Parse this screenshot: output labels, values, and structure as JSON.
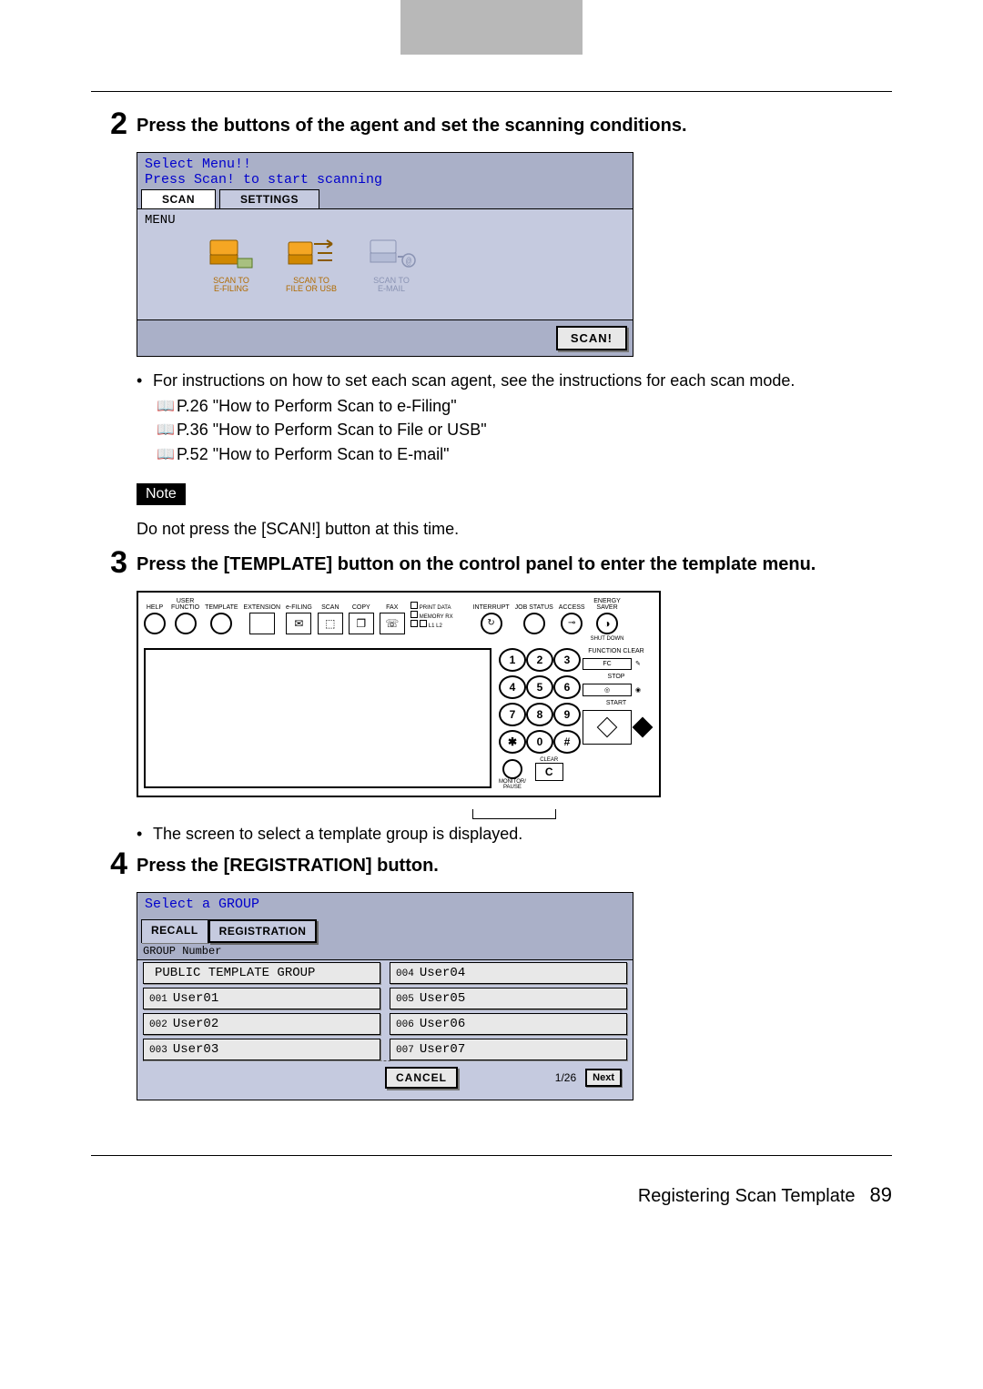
{
  "step2": {
    "num": "2",
    "title": "Press the buttons of the agent and set the scanning conditions.",
    "screen": {
      "title1": "Select Menu!!",
      "title2": "Press Scan! to start scanning",
      "tab_scan": "SCAN",
      "tab_settings": "SETTINGS",
      "menu_label": "MENU",
      "agents": {
        "efiling": "SCAN TO\nE-FILING",
        "fileusb": "SCAN TO\nFILE OR USB",
        "email": "SCAN TO\nE-MAIL"
      },
      "scan_btn": "SCAN!"
    },
    "bullet": "For instructions on how to set each scan agent, see the instructions for each scan mode.",
    "refs": {
      "r1": "P.26 \"How to Perform Scan to e-Filing\"",
      "r2": "P.36 \"How to Perform Scan to File or USB\"",
      "r3": "P.52 \"How to Perform Scan to E-mail\""
    },
    "note_label": "Note",
    "note_text": "Do not press the [SCAN!] button at this time."
  },
  "step3": {
    "num": "3",
    "title": "Press the [TEMPLATE] button on the control panel to enter the template menu.",
    "panel_labels": {
      "help": "HELP",
      "userfn": "USER\nFUNCTIO",
      "template": "TEMPLATE",
      "extension": "EXTENSION",
      "efiling": "e-FILING",
      "scan": "SCAN",
      "copy": "COPY",
      "fax": "FAX",
      "printdata": "PRINT DATA",
      "memoryrx": "MEMORY RX",
      "l1l2": "L1    L2",
      "interrupt": "INTERRUPT",
      "jobstatus": "JOB STATUS",
      "access": "ACCESS",
      "energy": "ENERGY\nSAVER",
      "shutdown": "SHUT DOWN",
      "functionclear": "FUNCTION CLEAR",
      "fc": "FC",
      "stop": "STOP",
      "start": "START",
      "monitor": "MONITOR/\nPAUSE",
      "clear": "CLEAR",
      "c": "C"
    },
    "bullet": "The screen to select a template group is displayed."
  },
  "step4": {
    "num": "4",
    "title": "Press the [REGISTRATION] button.",
    "screen": {
      "title": "Select a GROUP",
      "tab_recall": "RECALL",
      "tab_registration": "REGISTRATION",
      "group_number": "GROUP Number",
      "groups_left": [
        {
          "num": "",
          "label": "PUBLIC TEMPLATE GROUP"
        },
        {
          "num": "001",
          "label": "User01"
        },
        {
          "num": "002",
          "label": "User02"
        },
        {
          "num": "003",
          "label": "User03"
        }
      ],
      "groups_right": [
        {
          "num": "004",
          "label": "User04"
        },
        {
          "num": "005",
          "label": "User05"
        },
        {
          "num": "006",
          "label": "User06"
        },
        {
          "num": "007",
          "label": "User07"
        }
      ],
      "cancel": "CANCEL",
      "page": "1/26",
      "next": "Next"
    }
  },
  "footer": {
    "section": "Registering Scan Template",
    "page": "89"
  }
}
